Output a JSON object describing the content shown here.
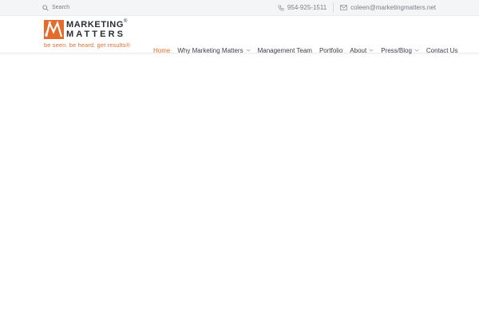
{
  "topbar": {
    "search_label": "Search",
    "phone": "954-925-1511",
    "email": "coleen@marketingmatters.net"
  },
  "logo": {
    "line1": "MARKETING",
    "line2": "MATTERS",
    "registered": "®",
    "tagline": "be seen. be heard. get results®"
  },
  "nav": {
    "items": [
      {
        "label": "Home",
        "active": true
      },
      {
        "label": "Why Marketing Matters",
        "dropdown": true
      },
      {
        "label": "Management Team"
      },
      {
        "label": "Portfolio"
      },
      {
        "label": "About",
        "dropdown": true
      },
      {
        "label": "Press/Blog",
        "dropdown": true
      },
      {
        "label": "Contact Us"
      }
    ]
  },
  "colors": {
    "accent": "#e36b2c",
    "topbar_bg": "#f4f5f6",
    "text": "#3b3f45"
  }
}
